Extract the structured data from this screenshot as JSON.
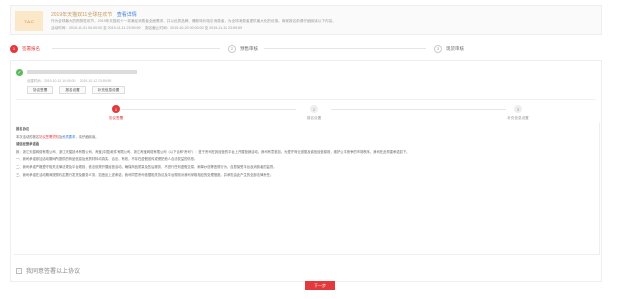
{
  "activity": {
    "thumb": "T.A.C",
    "title": "2019年天猫双11全球狂欢节",
    "link": "查看详情",
    "desc": "作为全球最大的购物狂欢节，2019年天猫双十一将满足消费者全面需求，并以优质品牌、爆款特价吸引消费者，为全球消费者提供最大化的优惠。商家报名前请仔细阅读以下内容。",
    "time": "活动时间：2019-11-01 00:00:00 至 2019-11-11 23:59:59　 报名截止时间：2019-10-20 00:00:00 至 2019-11-11 23:59:59"
  },
  "steps": [
    {
      "num": "1",
      "label": "签署报名"
    },
    {
      "num": "2",
      "label": "预售审核"
    },
    {
      "num": "3",
      "label": "现货审核"
    }
  ],
  "info": {
    "meta": "创建时间：2019-10-12 10:00:00　 2019-10-12 23:59:59",
    "ok_icon": "check-circle-icon",
    "buttons": [
      "协议签署",
      "报名设置",
      "补充信息设置"
    ]
  },
  "substeps": [
    {
      "num": "1",
      "label": "协议签署"
    },
    {
      "num": "2",
      "label": "报名设置"
    },
    {
      "num": "3",
      "label": "补充信息设置"
    }
  ],
  "doc": {
    "heading": "报名协议",
    "p1_pre": "本次活动的报名",
    "p1_red": "协议签署须知",
    "p1_mid": "及",
    "p1_blue": "资质要求",
    "p1_end": "，请仔细阅读。",
    "subheading": "诚信经营承诺函",
    "p2": "致：浙江天猫网络有限公司、浙江天猫技术有限公司、淘宝(中国)软件有限公司、浙江淘宝网络有限公司（以下合称“贵司”）：鉴于贵司在其经营的平台上开展营销活动，我司有意参加，为遵守商业道德及诚信经营原则，维护公平竞争的市场秩序，我司在此郑重承诺如下。",
    "p3": "一、我司承诺参加活动期间所提供的商品信息及资质材料均真实、合法、有效，不存在虚假宣传或侵犯他人合法权益的情形。",
    "p4": "二、我司承诺严格遵守相关法律法规及平台规则，依法依规开展经营活动，确保商品质量及售后服务，不进行任何虚假交易、刷单炒信等违规行为，自愿接受平台及消费者的监督。",
    "p5": "三、我司承诺在活动期间按照约定履行发货及服务义务，如违反上述承诺，我司同意贵司依据相关协议及平台规则对我司采取相应的处理措施，并承担由此产生的全部法律责任。"
  },
  "agree_label": "我同意签署以上协议",
  "next_label": "下一步"
}
